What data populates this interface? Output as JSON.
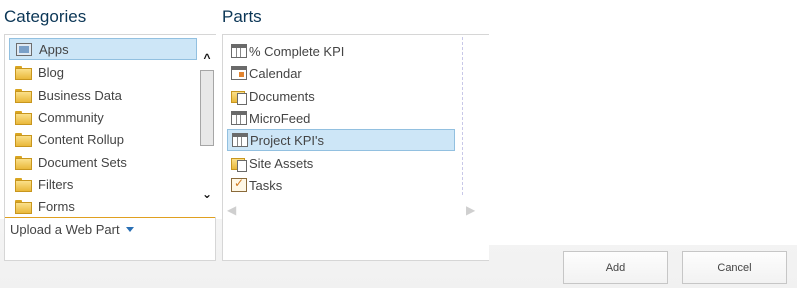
{
  "categories": {
    "heading": "Categories",
    "items": [
      {
        "label": "Apps",
        "icon": "apps-icon",
        "selected": true
      },
      {
        "label": "Blog",
        "icon": "folder-icon"
      },
      {
        "label": "Business Data",
        "icon": "folder-icon"
      },
      {
        "label": "Community",
        "icon": "folder-icon"
      },
      {
        "label": "Content Rollup",
        "icon": "folder-icon"
      },
      {
        "label": "Document Sets",
        "icon": "folder-icon"
      },
      {
        "label": "Filters",
        "icon": "folder-icon"
      },
      {
        "label": "Forms",
        "icon": "folder-icon"
      }
    ],
    "upload_label": "Upload a Web Part"
  },
  "parts": {
    "heading": "Parts",
    "items": [
      {
        "label": "% Complete KPI",
        "icon": "list-icon"
      },
      {
        "label": "Calendar",
        "icon": "calendar-icon"
      },
      {
        "label": "Documents",
        "icon": "document-library-icon"
      },
      {
        "label": "MicroFeed",
        "icon": "list-icon"
      },
      {
        "label": "Project KPI's",
        "icon": "list-icon",
        "selected": true
      },
      {
        "label": "Site Assets",
        "icon": "document-library-icon"
      },
      {
        "label": "Tasks",
        "icon": "tasks-icon"
      }
    ]
  },
  "buttons": {
    "add": "Add",
    "cancel": "Cancel"
  },
  "colors": {
    "heading": "#0b3656",
    "selection_bg": "#cde6f7",
    "selection_border": "#92c0e0",
    "divider": "#e0a020"
  }
}
